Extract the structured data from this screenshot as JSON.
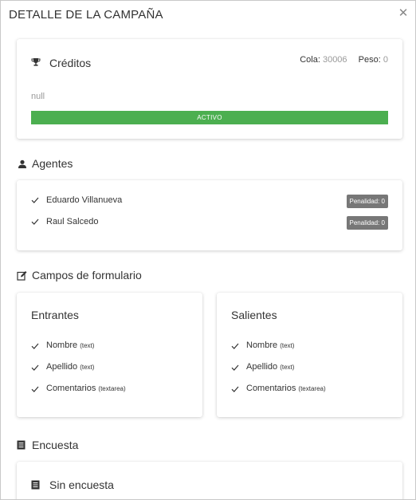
{
  "modal": {
    "title": "DETALLE DE LA CAMPAÑA",
    "close_icon": "close-icon"
  },
  "credits": {
    "icon": "trophy-icon",
    "title": "Créditos",
    "cola_label": "Cola:",
    "cola_value": "30006",
    "peso_label": "Peso:",
    "peso_value": "0",
    "description": "null",
    "status": "ACTIVO",
    "status_color": "#4caf50"
  },
  "agents": {
    "icon": "user-icon",
    "title": "Agentes",
    "items": [
      {
        "name": "Eduardo Villanueva",
        "penalty": "Penalidad: 0"
      },
      {
        "name": "Raul Salcedo",
        "penalty": "Penalidad: 0"
      }
    ]
  },
  "form_fields": {
    "icon": "edit-icon",
    "title": "Campos de formulario",
    "incoming": {
      "title": "Entrantes",
      "fields": [
        {
          "name": "Nombre",
          "type": "(text)"
        },
        {
          "name": "Apellido",
          "type": "(text)"
        },
        {
          "name": "Comentarios",
          "type": "(textarea)"
        }
      ]
    },
    "outgoing": {
      "title": "Salientes",
      "fields": [
        {
          "name": "Nombre",
          "type": "(text)"
        },
        {
          "name": "Apellido",
          "type": "(text)"
        },
        {
          "name": "Comentarios",
          "type": "(textarea)"
        }
      ]
    }
  },
  "survey": {
    "icon": "list-icon",
    "title": "Encuesta",
    "card_icon": "list-icon",
    "card_text": "Sin encuesta"
  }
}
